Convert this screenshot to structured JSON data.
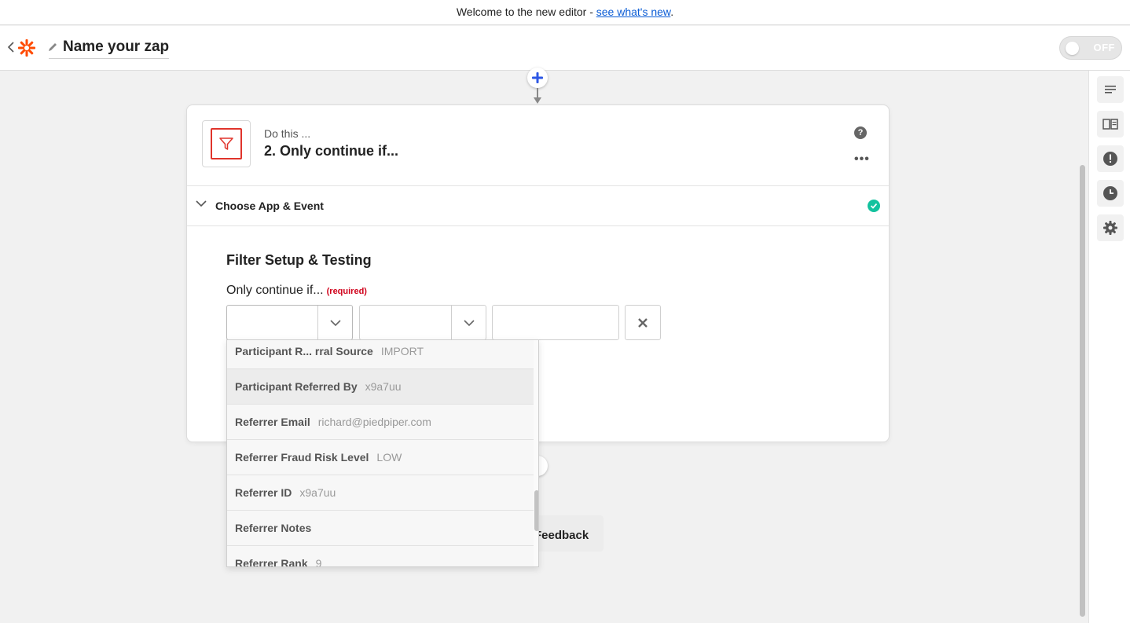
{
  "banner": {
    "text": "Welcome to the new editor - ",
    "link": "see what's new",
    "suffix": "."
  },
  "header": {
    "zap_name": "Name your zap",
    "toggle_label": "OFF"
  },
  "step": {
    "kicker": "Do this ...",
    "title": "2. Only continue if...",
    "help": "?",
    "more": "•••"
  },
  "section": {
    "title": "Choose App & Event"
  },
  "filter": {
    "title": "Filter Setup & Testing",
    "label": "Only continue if...",
    "required": "(required)"
  },
  "dropdown": {
    "items": [
      {
        "key": "Participant R... rral Source",
        "value": "IMPORT"
      },
      {
        "key": "Participant Referred By",
        "value": "x9a7uu"
      },
      {
        "key": "Referrer Email",
        "value": "richard@piedpiper.com"
      },
      {
        "key": "Referrer Fraud Risk Level",
        "value": "LOW"
      },
      {
        "key": "Referrer ID",
        "value": "x9a7uu"
      },
      {
        "key": "Referrer Notes",
        "value": ""
      },
      {
        "key": "Referrer Rank",
        "value": "9"
      }
    ]
  },
  "feedback": {
    "label": "Feedback"
  },
  "colors": {
    "accent": "#0b5cd5",
    "brand": "#ff4a00",
    "success": "#13c29e",
    "filter_red": "#e0342b"
  }
}
